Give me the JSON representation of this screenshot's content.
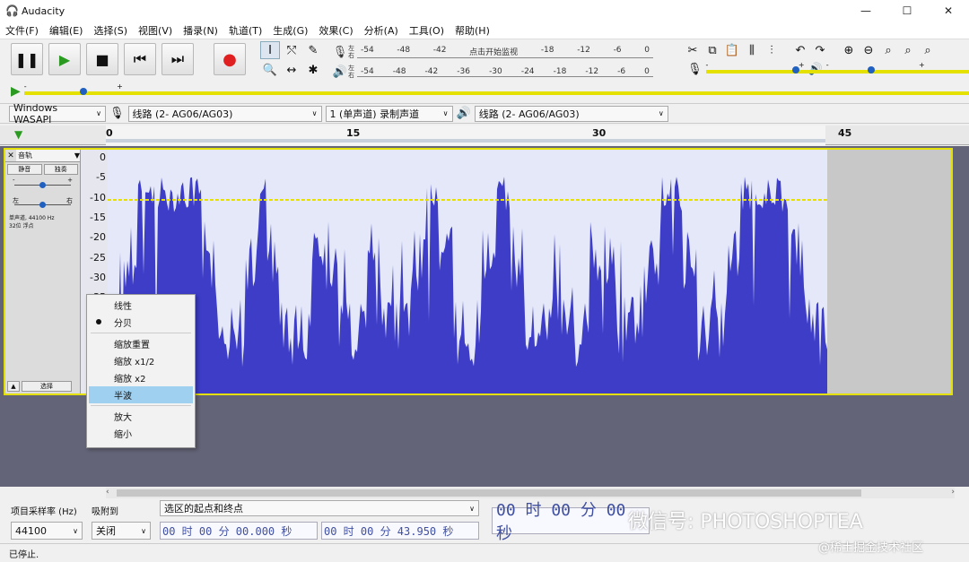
{
  "window": {
    "title": "Audacity"
  },
  "menu": [
    "文件(F)",
    "编辑(E)",
    "选择(S)",
    "视图(V)",
    "播录(N)",
    "轨道(T)",
    "生成(G)",
    "效果(C)",
    "分析(A)",
    "工具(O)",
    "帮助(H)"
  ],
  "meters": {
    "record_label_l": "左",
    "record_label_r": "右",
    "record_scale": [
      "-54",
      "-48",
      "-42",
      "点击开始监视",
      "-18",
      "-12",
      "-6",
      "0"
    ],
    "play_scale": [
      "-54",
      "-48",
      "-42",
      "-36",
      "-30",
      "-24",
      "-18",
      "-12",
      "-6",
      "0"
    ]
  },
  "sliders": {
    "minus": "-",
    "plus": "+"
  },
  "devices": {
    "host": "Windows WASAPI",
    "input": "线路 (2- AG06/AG03)",
    "channels": "1 (单声道) 录制声道",
    "output": "线路 (2- AG06/AG03)"
  },
  "timeline": {
    "ticks": [
      "0",
      "15",
      "30",
      "45"
    ]
  },
  "track": {
    "name": "音轨",
    "mute": "静音",
    "solo": "独奏",
    "gain_minus": "-",
    "gain_plus": "+",
    "pan_left": "左",
    "pan_right": "右",
    "format_line1": "单声道, 44100 Hz",
    "format_line2": "32位 浮点",
    "select": "选择",
    "scale": [
      "0",
      "-5",
      "-10",
      "-15",
      "-20",
      "-25",
      "-30",
      "-35"
    ]
  },
  "context_menu": {
    "items": [
      "线性",
      "分贝",
      "缩放重置",
      "缩放 x1/2",
      "缩放 x2",
      "半波",
      "放大",
      "缩小"
    ],
    "checked": "分贝",
    "highlighted": "半波"
  },
  "bottom": {
    "rate_label": "项目采样率 (Hz)",
    "rate_value": "44100",
    "snap_label": "吸附到",
    "snap_value": "关闭",
    "selection_label": "选区的起点和终点",
    "start_time": "00 时 00 分 00.000 秒",
    "end_time": "00 时 00 分 43.950 秒",
    "audio_pos": "00 时 00 分 00 秒"
  },
  "status": "已停止.",
  "watermark": {
    "main": "微信号: PHOTOSHOPTEA",
    "sub": "@稀土掘金技术社区"
  },
  "colors": {
    "waveform": "#3d3dc8",
    "selection_border": "#e4e000",
    "envelope": "#e8e000"
  }
}
